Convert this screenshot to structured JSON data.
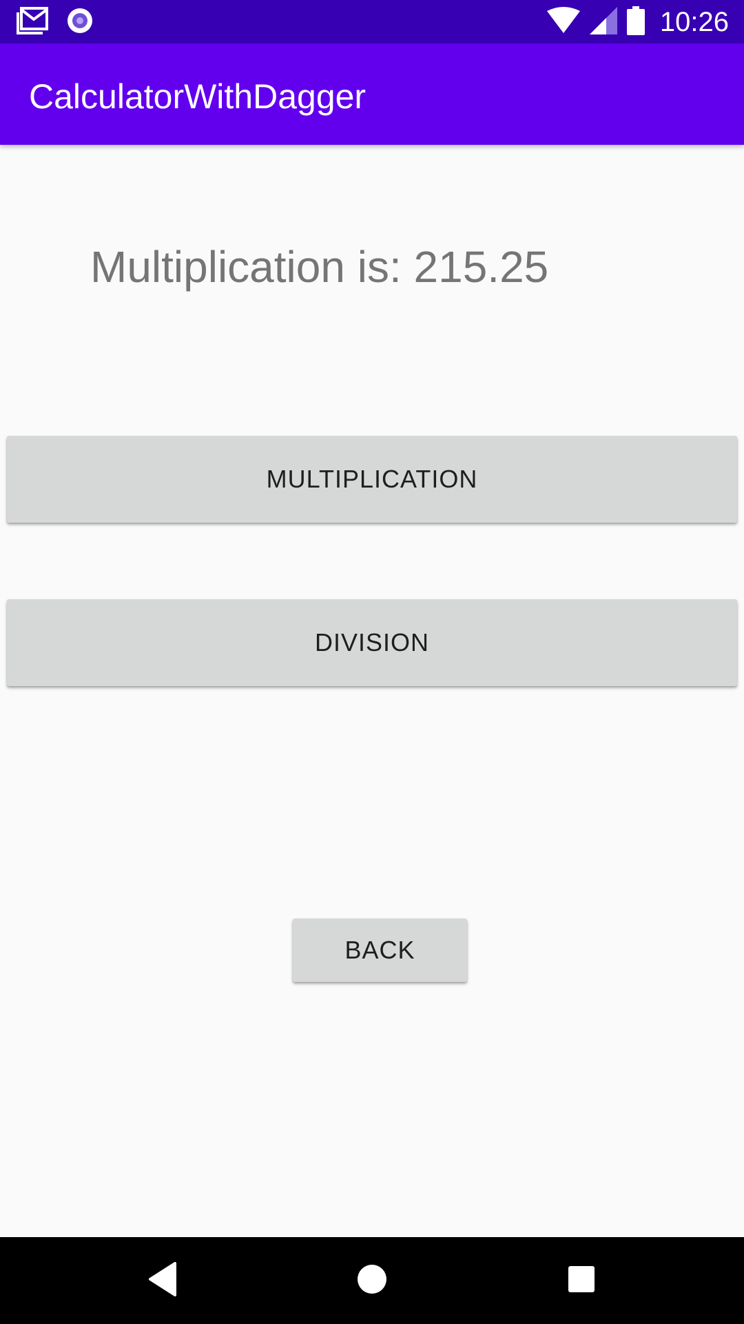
{
  "status_bar": {
    "time": "10:26",
    "left_icons": [
      "gmail-icon",
      "podcast-icon"
    ],
    "right_icons": [
      "wifi-icon",
      "signal-icon",
      "battery-icon"
    ]
  },
  "app_bar": {
    "title": "CalculatorWithDagger"
  },
  "main": {
    "result_text": "Multiplication is: 215.25",
    "buttons": {
      "multiplication_label": "MULTIPLICATION",
      "division_label": "DIVISION",
      "back_label": "BACK"
    }
  },
  "nav_bar": {
    "icons": [
      "back-triangle-icon",
      "home-circle-icon",
      "recents-square-icon"
    ]
  },
  "colors": {
    "status_bar": "#3700b3",
    "app_bar": "#6200ee",
    "background": "#fafafa",
    "button": "#d6d7d7",
    "result_text": "#757575",
    "nav_bar": "#000000"
  }
}
